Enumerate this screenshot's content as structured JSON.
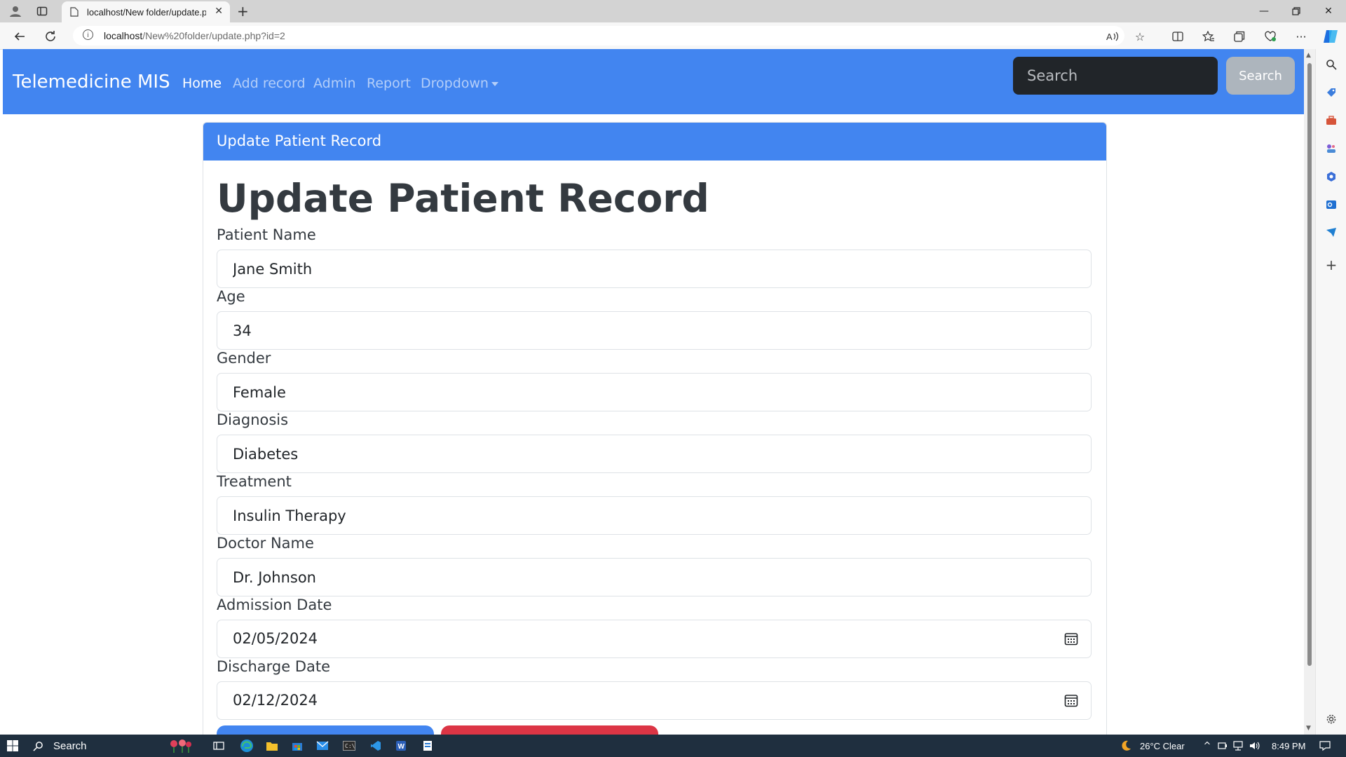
{
  "browser": {
    "tab_title": "localhost/New folder/update.php",
    "url_host": "localhost",
    "url_path": "/New%20folder/update.php?id=2"
  },
  "navbar": {
    "brand": "Telemedicine MIS",
    "links": [
      {
        "label": "Home",
        "active": true
      },
      {
        "label": "Add record",
        "active": false
      },
      {
        "label": "Admin",
        "active": false
      },
      {
        "label": "Report",
        "active": false
      },
      {
        "label": "Dropdown",
        "active": false
      }
    ],
    "search_placeholder": "Search",
    "search_button": "Search"
  },
  "card": {
    "header": "Update Patient Record",
    "title": "Update Patient Record",
    "fields": [
      {
        "label": "Patient Name",
        "value": "Jane Smith"
      },
      {
        "label": "Age",
        "value": "34"
      },
      {
        "label": "Gender",
        "value": "Female"
      },
      {
        "label": "Diagnosis",
        "value": "Diabetes"
      },
      {
        "label": "Treatment",
        "value": "Insulin Therapy"
      },
      {
        "label": "Doctor Name",
        "value": "Dr. Johnson"
      },
      {
        "label": "Admission Date",
        "value": "02/05/2024"
      },
      {
        "label": "Discharge Date",
        "value": "02/12/2024"
      }
    ]
  },
  "taskbar": {
    "search": "Search",
    "weather": "26°C  Clear",
    "time": "8:49 PM"
  },
  "colors": {
    "primary": "#4285f0",
    "danger": "#dc3545",
    "dark_input": "#212529",
    "secondary_button": "#adb5bd"
  }
}
